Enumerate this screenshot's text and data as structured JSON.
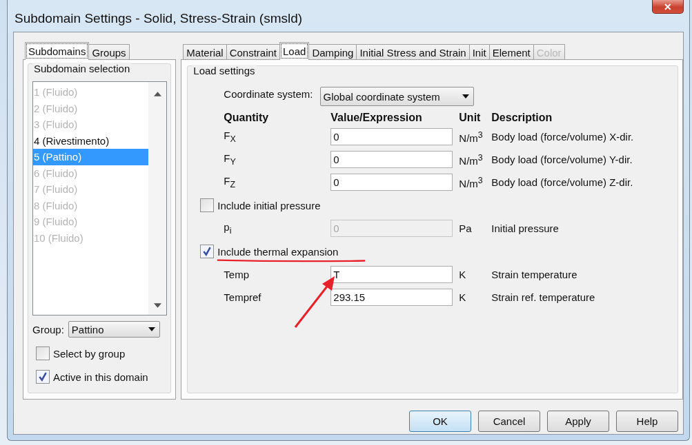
{
  "window": {
    "title": "Subdomain Settings - Solid, Stress-Strain (smsld)",
    "close": "✕"
  },
  "left_tabs": [
    {
      "label": "Subdomains",
      "selected": true
    },
    {
      "label": "Groups",
      "selected": false
    }
  ],
  "subdomain_selection": {
    "legend": "Subdomain selection",
    "items": [
      {
        "label": "1 (Fluido)",
        "disabled": true,
        "selected": false
      },
      {
        "label": "2 (Fluido)",
        "disabled": true,
        "selected": false
      },
      {
        "label": "3 (Fluido)",
        "disabled": true,
        "selected": false
      },
      {
        "label": "4 (Rivestimento)",
        "disabled": false,
        "selected": false
      },
      {
        "label": "5 (Pattino)",
        "disabled": true,
        "selected": true
      },
      {
        "label": "6 (Fluido)",
        "disabled": true,
        "selected": false
      },
      {
        "label": "7 (Fluido)",
        "disabled": true,
        "selected": false
      },
      {
        "label": "8 (Fluido)",
        "disabled": true,
        "selected": false
      },
      {
        "label": "9 (Fluido)",
        "disabled": true,
        "selected": false
      },
      {
        "label": "10 (Fluido)",
        "disabled": true,
        "selected": false
      }
    ],
    "group": {
      "label": "Group:",
      "value": "Pattino"
    },
    "checkboxes": [
      {
        "label": "Select by group",
        "checked": false
      },
      {
        "label": "Active in this domain",
        "checked": true
      }
    ]
  },
  "tabs": [
    {
      "label": "Material",
      "selected": false,
      "disabled": false
    },
    {
      "label": "Constraint",
      "selected": false,
      "disabled": false
    },
    {
      "label": "Load",
      "selected": true,
      "disabled": false
    },
    {
      "label": "Damping",
      "selected": false,
      "disabled": false
    },
    {
      "label": "Initial Stress and Strain",
      "selected": false,
      "disabled": false
    },
    {
      "label": "Init",
      "selected": false,
      "disabled": false
    },
    {
      "label": "Element",
      "selected": false,
      "disabled": false
    },
    {
      "label": "Color",
      "selected": false,
      "disabled": true
    }
  ],
  "load_settings": {
    "legend": "Load settings",
    "coordinate_system": {
      "label": "Coordinate system:",
      "value": "Global coordinate system"
    },
    "headers": [
      "Quantity",
      "Value/Expression",
      "Unit",
      "Description"
    ],
    "rows": [
      {
        "kind": "field",
        "quantity": "F$_{X}$",
        "value": "0",
        "unit": "N/m$^{3}$",
        "description": "Body load (force/volume) X-dir.",
        "disabled": false
      },
      {
        "kind": "field",
        "quantity": "F$_{Y}$",
        "value": "0",
        "unit": "N/m$^{3}$",
        "description": "Body load (force/volume) Y-dir.",
        "disabled": false
      },
      {
        "kind": "field",
        "quantity": "F$_{Z}$",
        "value": "0",
        "unit": "N/m$^{3}$",
        "description": "Body load (force/volume) Z-dir.",
        "disabled": false
      },
      {
        "kind": "checkbox",
        "label": "Include initial pressure",
        "checked": false
      },
      {
        "kind": "field",
        "quantity": "p$_{i}$",
        "value": "0",
        "unit": "Pa",
        "description": "Initial pressure",
        "disabled": true
      },
      {
        "kind": "checkbox",
        "label": "Include thermal expansion",
        "checked": true
      },
      {
        "kind": "field",
        "quantity": "Temp",
        "value": "T",
        "unit": "K",
        "description": "Strain temperature",
        "disabled": false
      },
      {
        "kind": "field",
        "quantity": "Tempref",
        "value": "293.15",
        "unit": "K",
        "description": "Strain ref. temperature",
        "disabled": false
      }
    ]
  },
  "buttons": [
    {
      "label": "OK",
      "default": true
    },
    {
      "label": "Cancel",
      "default": false
    },
    {
      "label": "Apply",
      "default": false
    },
    {
      "label": "Help",
      "default": false
    }
  ]
}
